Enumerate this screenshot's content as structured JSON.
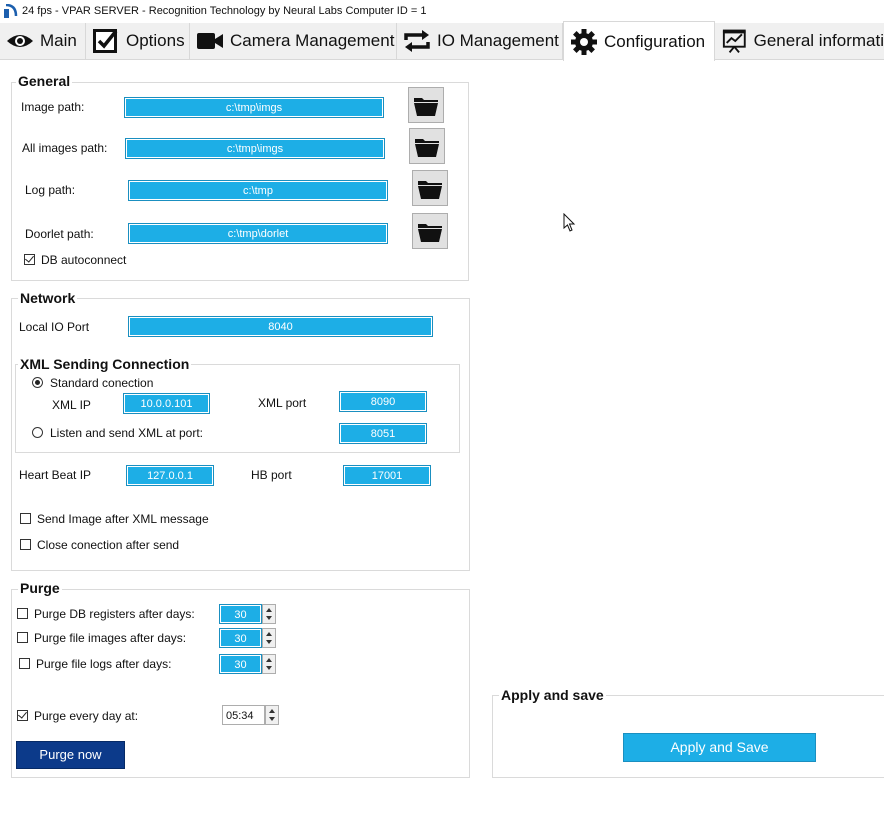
{
  "window": {
    "title": "24 fps - VPAR SERVER - Recognition Technology by Neural Labs Computer ID  = 1"
  },
  "tabs": [
    {
      "label": "Main",
      "icon": "eye-icon"
    },
    {
      "label": "Options",
      "icon": "checkbox-icon"
    },
    {
      "label": "Camera Management",
      "icon": "video-camera-icon"
    },
    {
      "label": "IO Management",
      "icon": "sync-arrows-icon"
    },
    {
      "label": "Configuration",
      "icon": "gear-icon",
      "active": true
    },
    {
      "label": "General informati",
      "icon": "presentation-chart-icon"
    }
  ],
  "general": {
    "title": "General",
    "image_path_label": "Image path:",
    "image_path_value": "c:\\tmp\\imgs",
    "all_images_path_label": "All images path:",
    "all_images_path_value": "c:\\tmp\\imgs",
    "log_path_label": "Log path:",
    "log_path_value": "c:\\tmp",
    "doorlet_path_label": "Doorlet path:",
    "doorlet_path_value": "c:\\tmp\\dorlet",
    "db_autoconnect_label": "DB autoconnect",
    "db_autoconnect_checked": true
  },
  "network": {
    "title": "Network",
    "local_io_port_label": "Local IO Port",
    "local_io_port_value": "8040",
    "xml_section_title": "XML Sending Connection",
    "standard_connection_label": "Standard conection",
    "standard_connection_selected": true,
    "xml_ip_label": "XML IP",
    "xml_ip_value": "10.0.0.101",
    "xml_port_label": "XML port",
    "xml_port_value": "8090",
    "listen_label": "Listen and send XML at port:",
    "listen_selected": false,
    "listen_port_value": "8051",
    "heartbeat_ip_label": "Heart Beat IP",
    "heartbeat_ip_value": "127.0.0.1",
    "hb_port_label": "HB port",
    "hb_port_value": "17001",
    "send_image_label": "Send Image after XML message",
    "send_image_checked": false,
    "close_connection_label": "Close conection after send",
    "close_connection_checked": false
  },
  "purge": {
    "title": "Purge",
    "db_registers_label": "Purge DB registers  after days:",
    "db_registers_checked": false,
    "db_registers_days": "30",
    "file_images_label": "Purge file images  after days:",
    "file_images_checked": false,
    "file_images_days": "30",
    "file_logs_label": "Purge file logs  after days:",
    "file_logs_checked": false,
    "file_logs_days": "30",
    "every_day_label": "Purge every day at:",
    "every_day_checked": true,
    "every_day_time": "05:34",
    "purge_now_label": "Purge now"
  },
  "apply": {
    "title": "Apply and save",
    "button_label": "Apply and Save"
  },
  "colors": {
    "field_blue": "#1daee6",
    "button_dark_blue": "#0c3a8a"
  }
}
